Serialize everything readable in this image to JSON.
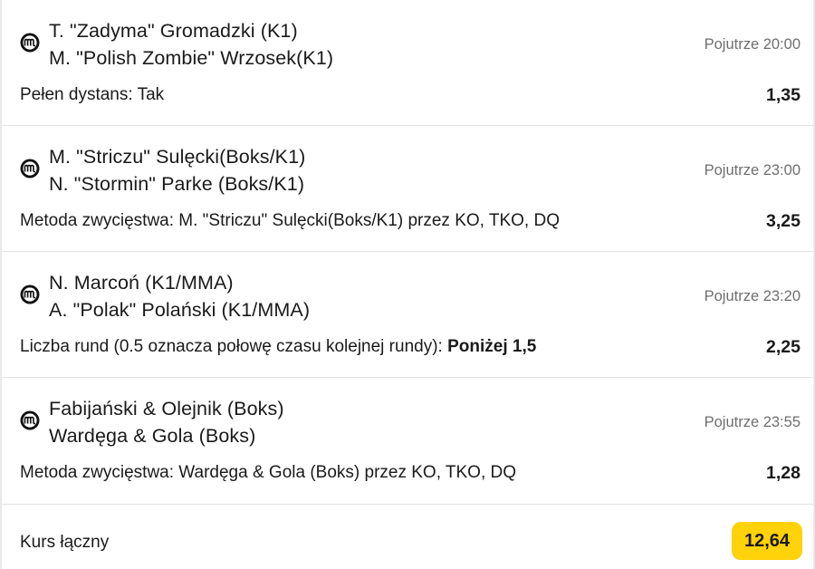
{
  "events": [
    {
      "fighter_1": "T. \"Zadyma\" Gromadzki (K1)",
      "fighter_2": "M. \"Polish Zombie\" Wrzosek(K1)",
      "time": "Pojutrze 20:00",
      "market": "Pełen dystans: ",
      "selection": "Tak",
      "odds": "1,35",
      "logo_icon": "mma-organization-logo-icon"
    },
    {
      "fighter_1": "M. \"Striczu\" Sulęcki(Boks/K1)",
      "fighter_2": "N. \"Stormin\" Parke (Boks/K1)",
      "time": "Pojutrze 23:00",
      "market": "Metoda zwycięstwa: ",
      "selection": "M. \"Striczu\" Sulęcki(Boks/K1) przez KO, TKO, DQ",
      "odds": "3,25",
      "logo_icon": "mma-organization-logo-icon"
    },
    {
      "fighter_1": "N. Marcoń (K1/MMA)",
      "fighter_2": "A. \"Polak\" Polański (K1/MMA)",
      "time": "Pojutrze 23:20",
      "market": "Liczba rund (0.5 oznacza połowę czasu kolejnej rundy): ",
      "selection": "Poniżej 1,5",
      "odds": "2,25",
      "logo_icon": "mma-organization-logo-icon"
    },
    {
      "fighter_1": "Fabijański & Olejnik (Boks)",
      "fighter_2": "Wardęga & Gola (Boks)",
      "time": "Pojutrze 23:55",
      "market": "Metoda zwycięstwa: ",
      "selection": "Wardęga & Gola (Boks) przez KO, TKO, DQ",
      "odds": "1,28",
      "logo_icon": "mma-organization-logo-icon"
    }
  ],
  "total": {
    "label": "Kurs łączny",
    "value": "12,64"
  },
  "colors": {
    "accent_badge": "#ffd20a",
    "time_text": "#6e6e6e",
    "divider": "#e3e3e3"
  }
}
